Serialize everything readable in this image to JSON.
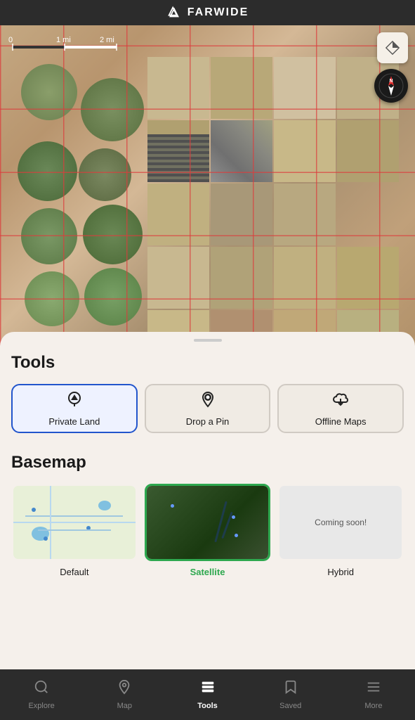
{
  "app": {
    "title": "FARWIDE"
  },
  "header": {
    "title": "FARWIDE"
  },
  "map": {
    "scale": {
      "label0": "0",
      "label1": "1 mi",
      "label2": "2 mi"
    }
  },
  "tools": {
    "section_title": "Tools",
    "buttons": [
      {
        "id": "private-land",
        "label": "Private Land",
        "active": true
      },
      {
        "id": "drop-pin",
        "label": "Drop a Pin",
        "active": false
      },
      {
        "id": "offline-maps",
        "label": "Offline Maps",
        "active": false
      }
    ]
  },
  "basemap": {
    "section_title": "Basemap",
    "options": [
      {
        "id": "default",
        "label": "Default",
        "selected": false
      },
      {
        "id": "satellite",
        "label": "Satellite",
        "selected": true
      },
      {
        "id": "hybrid",
        "label": "Hybrid",
        "selected": false,
        "coming_soon": "Coming soon!"
      }
    ]
  },
  "nav": {
    "items": [
      {
        "id": "explore",
        "label": "Explore",
        "active": false
      },
      {
        "id": "map",
        "label": "Map",
        "active": false
      },
      {
        "id": "tools",
        "label": "Tools",
        "active": true
      },
      {
        "id": "saved",
        "label": "Saved",
        "active": false
      },
      {
        "id": "more",
        "label": "More",
        "active": false
      }
    ]
  },
  "colors": {
    "active_blue": "#2255cc",
    "active_green": "#2ea84f",
    "nav_active": "#ffffff",
    "nav_inactive": "#888888"
  }
}
